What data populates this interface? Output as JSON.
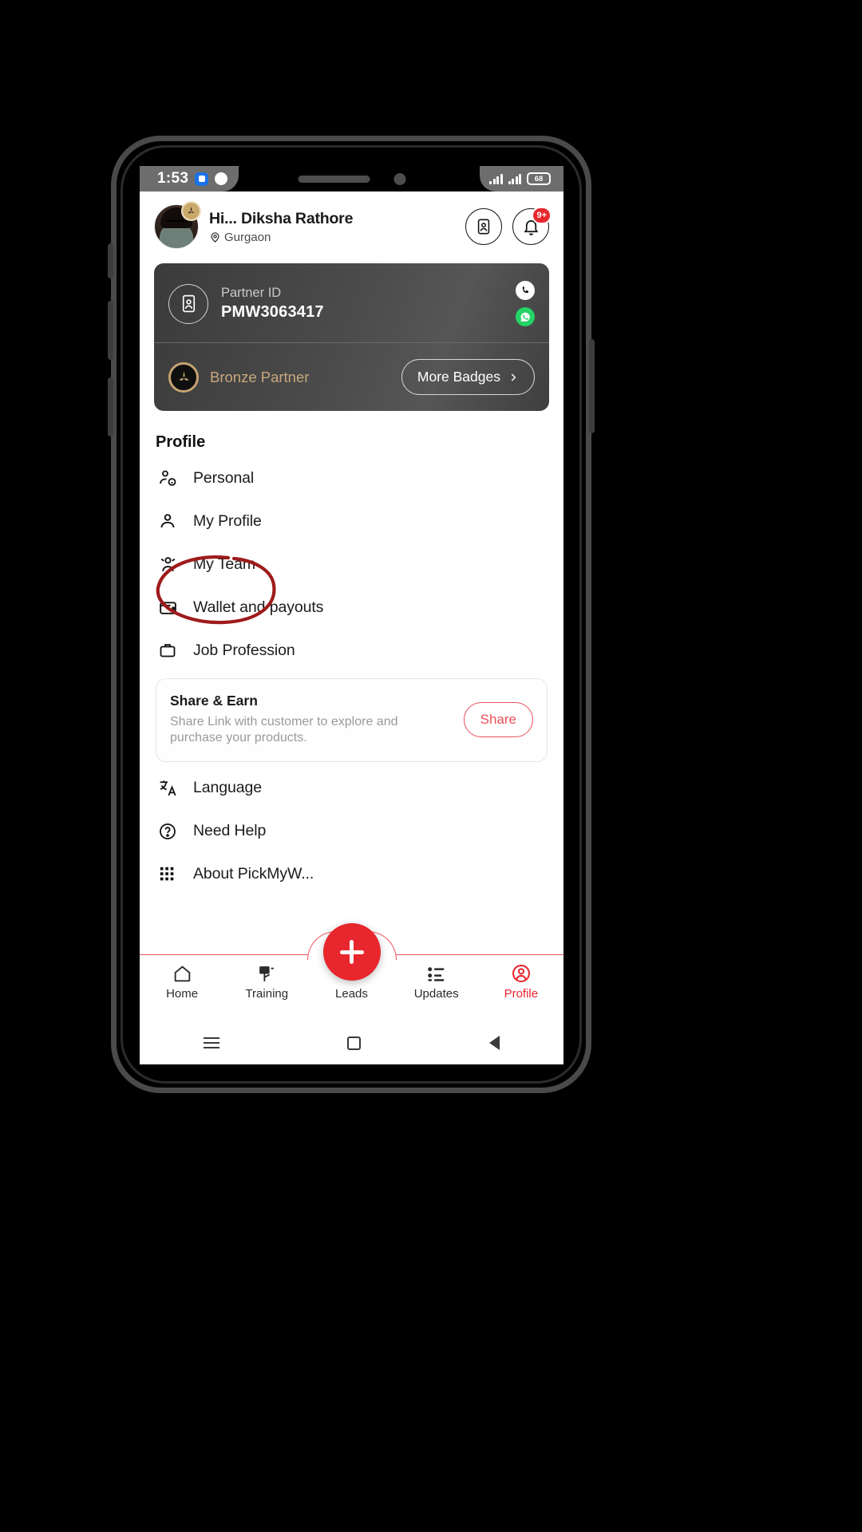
{
  "status_bar": {
    "time": "1:53",
    "battery": "68",
    "icons": [
      "messages-icon",
      "app-icon",
      "signal-icon",
      "signal-icon",
      "battery-icon"
    ]
  },
  "header": {
    "greeting_name": "Hi... Diksha Rathore",
    "location": "Gurgaon",
    "location_icon": "location-pin-icon",
    "id_card_button": "id-card-icon",
    "notification_button": "bell-icon",
    "notification_count": "9+"
  },
  "partner_card": {
    "id_label": "Partner ID",
    "id_value": "PMW3063417",
    "id_icon": "id-badge-icon",
    "phone_icon": "phone-icon",
    "whatsapp_icon": "whatsapp-icon",
    "tier_label": "Bronze Partner",
    "tier_icon": "bronze-badge-icon",
    "more_badges_label": "More Badges",
    "more_badges_icon": "chevron-right-icon",
    "tier_color": "#c8a87e"
  },
  "profile_section": {
    "title": "Profile",
    "items": [
      {
        "label": "Personal",
        "icon": "person-info-icon"
      },
      {
        "label": "My Profile",
        "icon": "person-icon"
      },
      {
        "label": "My Team",
        "icon": "people-icon"
      },
      {
        "label": "Wallet and payouts",
        "icon": "wallet-icon"
      },
      {
        "label": "Job Profession",
        "icon": "briefcase-icon"
      }
    ],
    "items_after": [
      {
        "label": "Language",
        "icon": "translate-icon"
      },
      {
        "label": "Need Help",
        "icon": "help-circle-icon"
      },
      {
        "label": "About PickMyW...",
        "icon": "grid-icon"
      }
    ]
  },
  "share_card": {
    "title": "Share & Earn",
    "subtitle": "Share Link with customer to explore and purchase your products.",
    "button_label": "Share",
    "button_color": "#e8525a"
  },
  "bottom_nav": {
    "fab_icon": "plus-icon",
    "accent_color": "#e8262d",
    "items": [
      {
        "label": "Home",
        "icon": "home-icon",
        "active": false
      },
      {
        "label": "Training",
        "icon": "training-icon",
        "active": false
      },
      {
        "label": "Leads",
        "icon": "leads-icon",
        "active": false
      },
      {
        "label": "Updates",
        "icon": "updates-icon",
        "active": false
      },
      {
        "label": "Profile",
        "icon": "profile-icon",
        "active": true
      }
    ]
  },
  "system_nav": {
    "menu_icon": "menu-icon",
    "home_icon": "square-home-icon",
    "back_icon": "back-triangle-icon"
  },
  "annotation": {
    "shape": "hand-drawn-ellipse",
    "color": "#9e1b1b",
    "targets": "My Profile"
  }
}
